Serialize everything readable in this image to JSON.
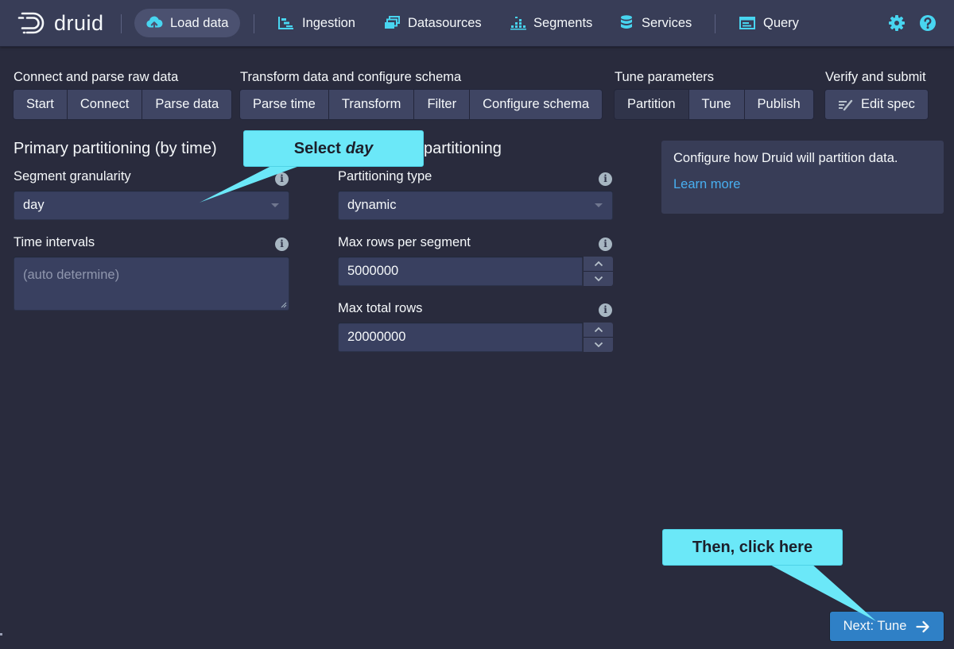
{
  "brand": {
    "name": "druid"
  },
  "nav": {
    "load_data": "Load data",
    "ingestion": "Ingestion",
    "datasources": "Datasources",
    "segments": "Segments",
    "services": "Services",
    "query": "Query",
    "icons": [
      "upload-icon",
      "ingestion-icon",
      "datasources-icon",
      "segments-icon",
      "services-icon",
      "query-icon",
      "gear-icon",
      "help-icon"
    ]
  },
  "steps": {
    "groups": [
      {
        "title": "Connect and parse raw data",
        "buttons": [
          "Start",
          "Connect",
          "Parse data"
        ]
      },
      {
        "title": "Transform data and configure schema",
        "buttons": [
          "Parse time",
          "Transform",
          "Filter",
          "Configure schema"
        ]
      },
      {
        "title": "Tune parameters",
        "buttons": [
          "Partition",
          "Tune",
          "Publish"
        ]
      },
      {
        "title": "Verify and submit",
        "buttons": [
          "Edit spec"
        ]
      }
    ],
    "active": "Partition"
  },
  "primary": {
    "title": "Primary partitioning (by time)",
    "segment_granularity_label": "Segment granularity",
    "segment_granularity_value": "day",
    "time_intervals_label": "Time intervals",
    "time_intervals_placeholder": "(auto determine)"
  },
  "secondary": {
    "title_visible": "partitioning",
    "partitioning_type_label": "Partitioning type",
    "partitioning_type_value": "dynamic",
    "max_rows_per_segment_label": "Max rows per segment",
    "max_rows_per_segment_value": "5000000",
    "max_total_rows_label": "Max total rows",
    "max_total_rows_value": "20000000"
  },
  "info_panel": {
    "message": "Configure how Druid will partition data.",
    "link": "Learn more"
  },
  "next_button": "Next: Tune",
  "callouts": {
    "select_prefix": "Select",
    "select_value": "day",
    "click": "Then, click here"
  },
  "colors": {
    "background": "#292b3d",
    "nav": "#383d57",
    "accent": "#2f80c6",
    "link": "#48aff0",
    "callout": "#6be8f8"
  }
}
